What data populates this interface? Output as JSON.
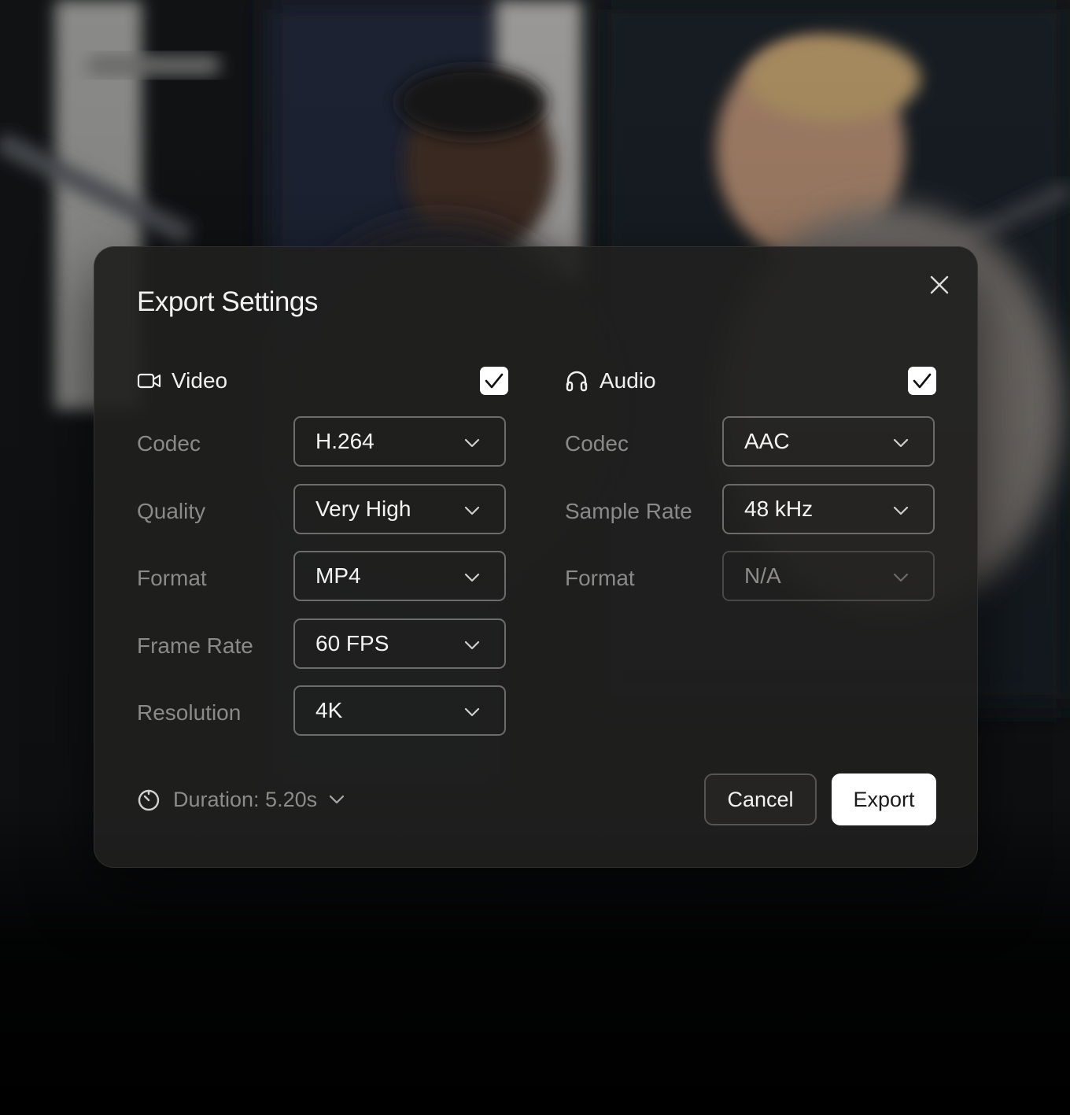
{
  "dialog": {
    "title": "Export Settings",
    "close_icon": "close-icon"
  },
  "video": {
    "header": "Video",
    "icon": "video-camera-icon",
    "enabled": true,
    "rows": [
      {
        "label": "Codec",
        "value": "H.264"
      },
      {
        "label": "Quality",
        "value": "Very High"
      },
      {
        "label": "Format",
        "value": "MP4"
      },
      {
        "label": "Frame Rate",
        "value": "60 FPS"
      },
      {
        "label": "Resolution",
        "value": "4K"
      }
    ]
  },
  "audio": {
    "header": "Audio",
    "icon": "headphones-icon",
    "enabled": true,
    "rows": [
      {
        "label": "Codec",
        "value": "AAC"
      },
      {
        "label": "Sample Rate",
        "value": "48 kHz"
      },
      {
        "label": "Format",
        "value": "N/A",
        "disabled": true
      }
    ]
  },
  "footer": {
    "duration_label": "Duration: 5.20s",
    "duration_icon": "timer-icon",
    "cancel_label": "Cancel",
    "export_label": "Export"
  },
  "colors": {
    "dialog_bg": "#201f1e",
    "label_text": "#8a8a8a",
    "value_text": "#f3f3f3",
    "select_border": "#6e6c6a",
    "primary_button": "#ffffff"
  }
}
